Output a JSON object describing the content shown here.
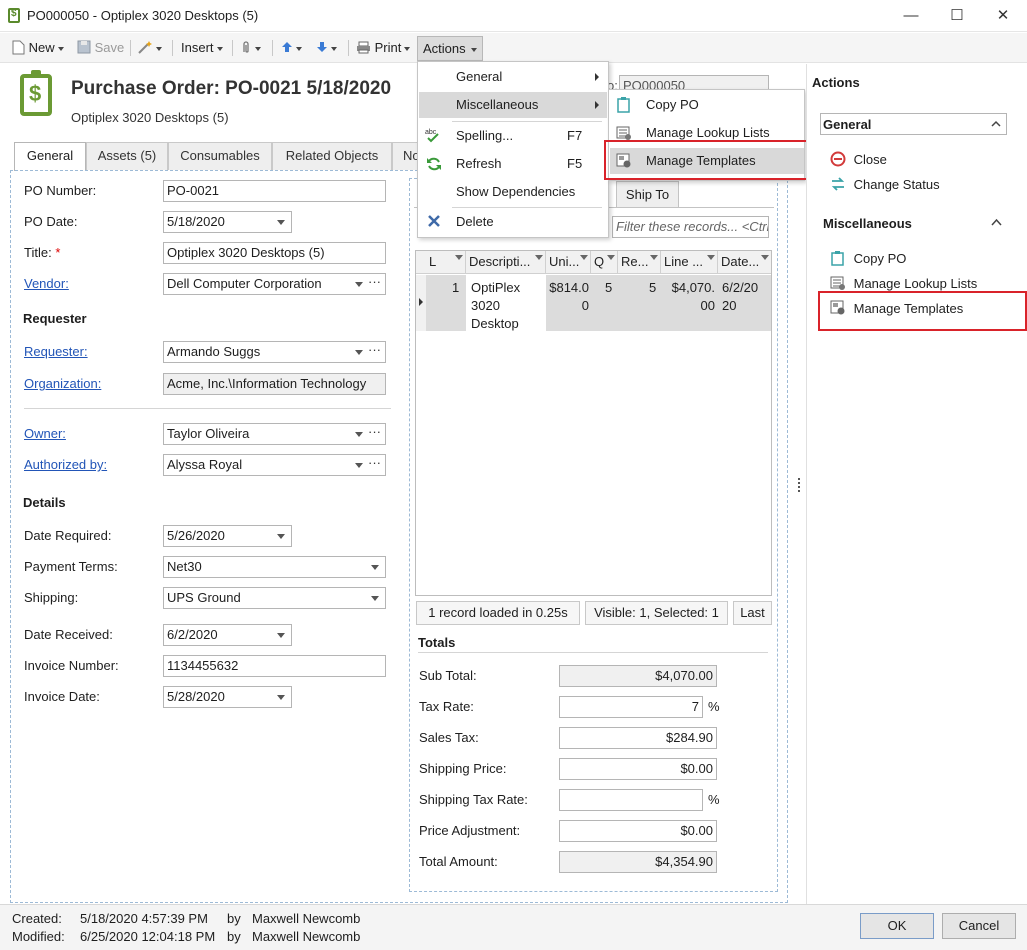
{
  "window": {
    "title": "PO000050 - Optiplex 3020 Desktops (5)",
    "minimize": "—",
    "maximize": "☐",
    "close": "✕"
  },
  "toolbar": {
    "new": "New",
    "save": "Save",
    "insert": "Insert",
    "print": "Print",
    "actions": "Actions"
  },
  "header": {
    "title": "Purchase Order: PO-0021 5/18/2020",
    "subtitle": "Optiplex 3020 Desktops (5)"
  },
  "tabs": [
    "General",
    "Assets (5)",
    "Consumables",
    "Related Objects",
    "No"
  ],
  "form": {
    "po_number_label": "PO Number:",
    "po_number": "PO-0021",
    "po_date_label": "PO Date:",
    "po_date": "5/18/2020",
    "title_label": "Title:",
    "title_required": "*",
    "title": "Optiplex 3020 Desktops (5)",
    "vendor_label": "Vendor:",
    "vendor": "Dell Computer Corporation",
    "requester_section": "Requester",
    "requester_label": "Requester:",
    "requester": "Armando Suggs",
    "organization_label": "Organization:",
    "organization": "Acme, Inc.\\Information Technology",
    "owner_label": "Owner:",
    "owner": "Taylor Oliveira",
    "authorized_label": "Authorized by:",
    "authorized": "Alyssa Royal",
    "details_section": "Details",
    "date_required_label": "Date Required:",
    "date_required": "5/26/2020",
    "payment_terms_label": "Payment Terms:",
    "payment_terms": "Net30",
    "shipping_label": "Shipping:",
    "shipping": "UPS Ground",
    "date_received_label": "Date Received:",
    "date_received": "6/2/2020",
    "invoice_number_label": "Invoice Number:",
    "invoice_number": "1134455632",
    "invoice_date_label": "Invoice Date:",
    "invoice_date": "5/28/2020",
    "more_dots": "···"
  },
  "right_panel": {
    "po_partial_label": "o:",
    "po_partial_value": "PO000050",
    "ship_to_tab": "Ship To",
    "filter_placeholder": "Filter these records... <Ctrl-",
    "grid_headers": [
      "L",
      "Descripti...",
      "Uni...",
      "Q",
      "Re...",
      "Line ...",
      "Date..."
    ],
    "grid_row": {
      "line": "1",
      "desc": "OptiPlex 3020 Desktop",
      "unit": "$814.00",
      "qty": "5",
      "rec": "5",
      "line_total": "$4,070.00",
      "date": "6/2/2020"
    },
    "status_loaded": "1 record loaded in 0.25s",
    "status_visible": "Visible: 1, Selected: 1",
    "status_last": "Last",
    "totals_section": "Totals",
    "sub_total_label": "Sub Total:",
    "sub_total": "$4,070.00",
    "tax_rate_label": "Tax Rate:",
    "tax_rate": "7",
    "pct": "%",
    "sales_tax_label": "Sales Tax:",
    "sales_tax": "$284.90",
    "shipping_price_label": "Shipping Price:",
    "shipping_price": "$0.00",
    "shipping_tax_label": "Shipping Tax Rate:",
    "shipping_tax": "",
    "price_adj_label": "Price Adjustment:",
    "price_adj": "$0.00",
    "total_label": "Total Amount:",
    "total": "$4,354.90"
  },
  "actions_menu": {
    "general": "General",
    "misc": "Miscellaneous",
    "spelling": "Spelling...",
    "spelling_key": "F7",
    "refresh": "Refresh",
    "refresh_key": "F5",
    "show_deps": "Show Dependencies",
    "delete": "Delete"
  },
  "misc_submenu": {
    "copy_po": "Copy PO",
    "manage_lookup": "Manage Lookup Lists",
    "manage_templates": "Manage Templates"
  },
  "actions_pane": {
    "title": "Actions",
    "general": "General",
    "close": "Close",
    "change_status": "Change Status",
    "misc": "Miscellaneous",
    "copy_po": "Copy PO",
    "manage_lookup": "Manage Lookup Lists",
    "manage_templates": "Manage Templates"
  },
  "footer": {
    "created_label": "Created:",
    "created_date": "5/18/2020 4:57:39 PM",
    "created_by_label": "by",
    "created_by": "Maxwell Newcomb",
    "modified_label": "Modified:",
    "modified_date": "6/25/2020 12:04:18 PM",
    "modified_by_label": "by",
    "modified_by": "Maxwell Newcomb",
    "ok": "OK",
    "cancel": "Cancel"
  },
  "colors": {
    "accent_green": "#6b9a34",
    "link_blue": "#2255b7",
    "highlight_red": "#d9232a",
    "dashed_border": "#9dbad6"
  },
  "icons": [
    "po-form-icon",
    "new-icon",
    "save-icon",
    "wand-icon",
    "attach-icon",
    "up-arrow-icon",
    "down-arrow-icon",
    "print-icon",
    "spelling-icon",
    "refresh-icon",
    "delete-icon",
    "copy-icon",
    "lookup-icon",
    "templates-icon",
    "close-circle-icon",
    "change-status-icon"
  ]
}
